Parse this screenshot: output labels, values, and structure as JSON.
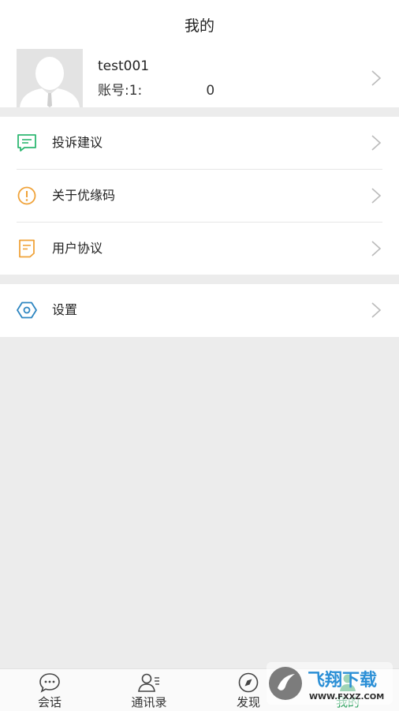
{
  "header": {
    "title": "我的"
  },
  "profile": {
    "username": "test001",
    "account": "账号:1:               0"
  },
  "menu": {
    "items": [
      {
        "label": "投诉建议",
        "icon": "feedback-message-icon",
        "color": "#2eb872"
      },
      {
        "label": "关于优缘码",
        "icon": "info-exclamation-icon",
        "color": "#f0a33a"
      },
      {
        "label": "用户协议",
        "icon": "document-icon",
        "color": "#f0a33a"
      }
    ],
    "settings": {
      "label": "设置",
      "icon": "settings-hexagon-icon",
      "color": "#2e86c1"
    }
  },
  "tabbar": {
    "tabs": [
      {
        "label": "会话",
        "icon": "chat-bubble-icon"
      },
      {
        "label": "通讯录",
        "icon": "contacts-icon"
      },
      {
        "label": "发现",
        "icon": "compass-icon"
      },
      {
        "label": "我的",
        "icon": "profile-icon",
        "active": true
      }
    ]
  },
  "colors": {
    "accent": "#2aa15d",
    "background": "#ececec"
  },
  "watermark": {
    "text": "飞翔下载",
    "subtext": "WWW.FXXZ.COM"
  }
}
